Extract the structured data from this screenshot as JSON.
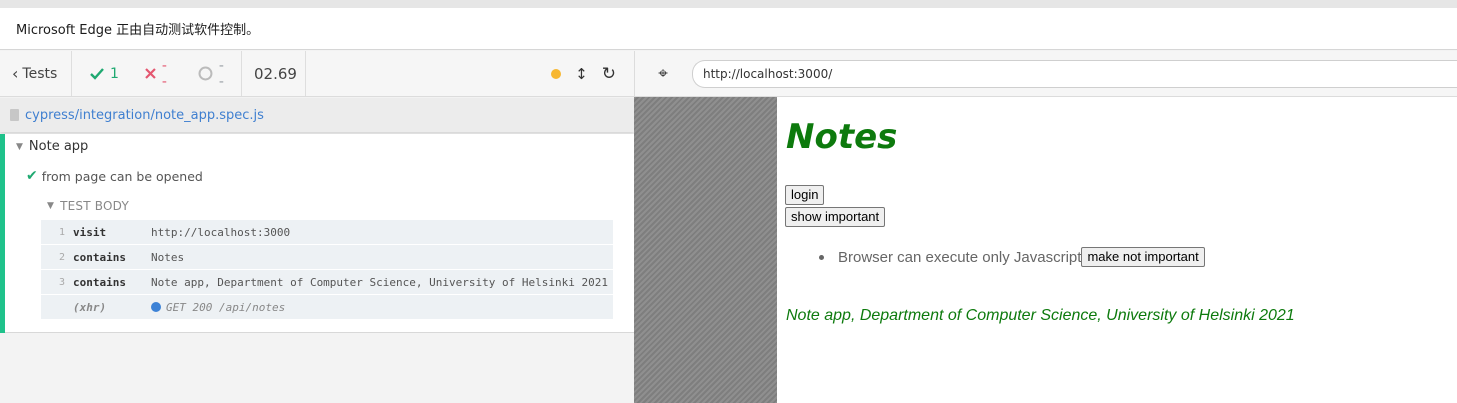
{
  "browser_banner": {
    "text": "Microsoft Edge 正由自动测试软件控制。"
  },
  "reporter": {
    "tests_label": "Tests",
    "passed_count": "1",
    "failed_count": "--",
    "pending_count": "--",
    "duration": "02.69",
    "status_color": "#f7b731"
  },
  "spec": {
    "path": "cypress/integration/note_app.spec.js"
  },
  "suite": {
    "title": "Note app",
    "test": {
      "title": "from page can be opened",
      "status": "passed",
      "body_label": "TEST BODY",
      "commands": [
        {
          "num": "1",
          "name": "visit",
          "message": "http://localhost:3000"
        },
        {
          "num": "2",
          "name": "contains",
          "message": "Notes"
        },
        {
          "num": "3",
          "name": "contains",
          "message": "Note app, Department of Computer Science, University of Helsinki 2021"
        },
        {
          "num": "",
          "name": "(xhr)",
          "message": "GET 200 /api/notes"
        }
      ]
    }
  },
  "aut": {
    "url": "http://localhost:3000/",
    "app": {
      "title": "Notes",
      "login_button": "login",
      "show_button": "show important",
      "notes": [
        {
          "content": "Browser can execute only Javascript",
          "button": "make not important"
        }
      ],
      "footer": "Note app, Department of Computer Science, University of Helsinki 2021",
      "accent_color": "#0d7a0d"
    }
  },
  "icons": [
    "chevron-left-icon",
    "check-icon",
    "x-icon",
    "pending-circle-icon",
    "resize-arrows-icon",
    "reload-icon",
    "file-icon",
    "triangle-down-icon",
    "crosshair-icon"
  ]
}
